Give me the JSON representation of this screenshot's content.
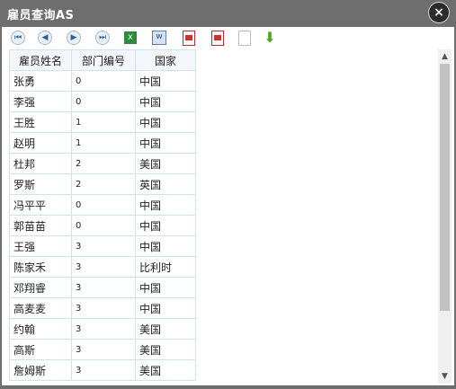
{
  "window": {
    "title": "雇员查询AS",
    "close_symbol": "×"
  },
  "toolbar": {
    "items": [
      {
        "icon": "first-page-icon"
      },
      {
        "icon": "prev-page-icon"
      },
      {
        "icon": "next-page-icon"
      },
      {
        "icon": "last-page-icon"
      },
      {
        "icon": "excel-export-icon"
      },
      {
        "icon": "word-export-icon"
      },
      {
        "icon": "pdf-export-icon"
      },
      {
        "icon": "pdf-export-icon"
      },
      {
        "icon": "blank-document-icon"
      },
      {
        "icon": "download-arrow-icon"
      }
    ]
  },
  "table": {
    "headers": [
      "雇员姓名",
      "部门编号",
      "国家"
    ],
    "rows": [
      [
        "张勇",
        "0",
        "中国"
      ],
      [
        "李强",
        "0",
        "中国"
      ],
      [
        "王胜",
        "1",
        "中国"
      ],
      [
        "赵明",
        "1",
        "中国"
      ],
      [
        "杜邦",
        "2",
        "美国"
      ],
      [
        "罗斯",
        "2",
        "英国"
      ],
      [
        "冯平平",
        "0",
        "中国"
      ],
      [
        "郭苗苗",
        "0",
        "中国"
      ],
      [
        "王强",
        "3",
        "中国"
      ],
      [
        "陈家禾",
        "3",
        "比利时"
      ],
      [
        "邓翔睿",
        "3",
        "中国"
      ],
      [
        "高麦麦",
        "3",
        "中国"
      ],
      [
        "约翰",
        "3",
        "美国"
      ],
      [
        "高斯",
        "3",
        "美国"
      ],
      [
        "詹姆斯",
        "3",
        "美国"
      ]
    ]
  }
}
